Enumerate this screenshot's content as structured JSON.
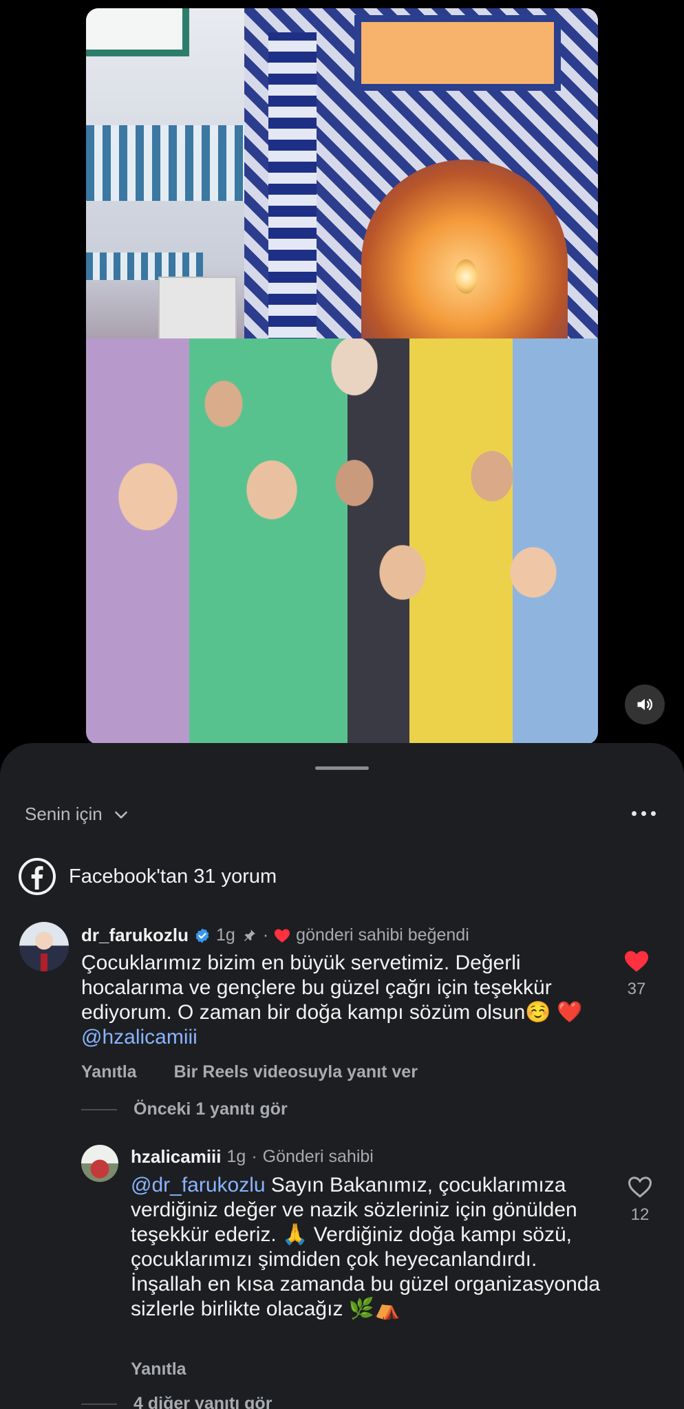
{
  "sheet": {
    "filter_label": "Senin için",
    "source_label": "Facebook'tan 31 yorum"
  },
  "comments": [
    {
      "username": "dr_farukozlu",
      "time": "1g",
      "separator": "·",
      "author_liked": "gönderi sahibi beğendi",
      "text": "Çocuklarımız bizim en büyük servetimiz. Değerli hocalarıma ve gençlere bu güzel çağrı için teşekkür ediyorum. O zaman bir doğa kampı sözüm olsun☺️ ❤️",
      "mention": "@hzalicamiii",
      "like_count": "37",
      "reply_label": "Yanıtla",
      "reels_reply_label": "Bir Reels videosuyla yanıt ver",
      "previous_replies": "Önceki 1 yanıtı gör"
    },
    {
      "username": "hzalicamiii",
      "time": "1g",
      "separator": "·",
      "badge": "Gönderi sahibi",
      "mention": "@dr_farukozlu",
      "text": "Sayın Bakanımız, çocuklarımıza verdiğiniz değer ve nazik sözleriniz için gönülden teşekkür ederiz. 🙏 Verdiğiniz doğa kampı sözü, çocuklarımızı şimdiden çok heyecanlandırdı. İnşallah en kısa zamanda bu güzel organizasyonda sizlerle birlikte olacağız 🌿⛺",
      "like_count": "12",
      "reply_label": "Yanıtla",
      "more_replies": "4 diğer yanıtı gör"
    }
  ],
  "colors": {
    "sheet_bg": "#1c1e21",
    "like_red": "#ff3040",
    "verified_blue": "#3897f0",
    "mention": "#8ab4ff"
  },
  "icons": [
    "speaker-icon",
    "chevron-down-icon",
    "more-icon",
    "facebook-icon",
    "verified-icon",
    "pin-icon",
    "heart-icon"
  ]
}
